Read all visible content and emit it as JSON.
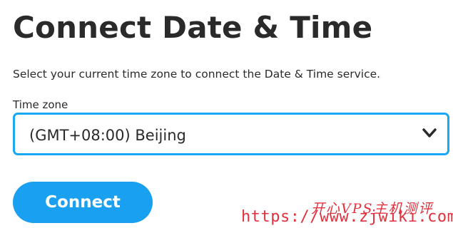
{
  "page": {
    "title": "Connect Date & Time",
    "description": "Select your current time zone to connect the Date & Time service."
  },
  "timezone_field": {
    "label": "Time zone",
    "selected_value": "(GMT+08:00) Beijing",
    "icon": "chevron-down-icon"
  },
  "actions": {
    "connect_label": "Connect"
  },
  "watermark": {
    "line1": "开心VPS主机测评",
    "line2": "https://www.zjwiki.com"
  },
  "colors": {
    "accent": "#1aa0f0",
    "select_border": "#1aa7f3",
    "text": "#2a2a2a",
    "watermark": "#e0323e"
  }
}
